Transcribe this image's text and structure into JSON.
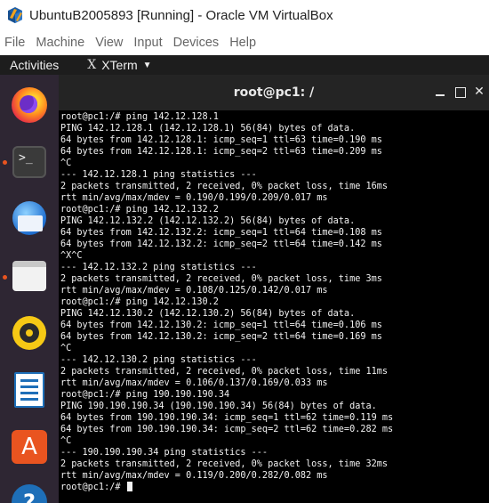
{
  "window": {
    "title": "UbuntuB2005893 [Running] - Oracle VM VirtualBox"
  },
  "menubar": {
    "items": [
      "File",
      "Machine",
      "View",
      "Input",
      "Devices",
      "Help"
    ]
  },
  "topbar": {
    "activities": "Activities",
    "app_glyph": "X",
    "app_name": "XTerm"
  },
  "dock": {
    "items": [
      {
        "name": "firefox",
        "icon": "firefox-icon",
        "running": false
      },
      {
        "name": "terminal",
        "icon": "terminal-icon",
        "glyph": ">_",
        "running": true
      },
      {
        "name": "thunderbird",
        "icon": "thunderbird-icon",
        "running": false
      },
      {
        "name": "files",
        "icon": "files-icon",
        "running": true
      },
      {
        "name": "rhythmbox",
        "icon": "rhythmbox-icon",
        "running": false
      },
      {
        "name": "libreoffice-writer",
        "icon": "writer-icon",
        "running": false
      },
      {
        "name": "software",
        "icon": "software-icon",
        "glyph": "A",
        "running": false
      },
      {
        "name": "help",
        "icon": "help-icon",
        "glyph": "?",
        "running": false
      }
    ]
  },
  "terminal": {
    "title": "root@pc1: /",
    "close_glyph": "✕",
    "lines": [
      "root@pc1:/# ping 142.12.128.1",
      "PING 142.12.128.1 (142.12.128.1) 56(84) bytes of data.",
      "64 bytes from 142.12.128.1: icmp_seq=1 ttl=63 time=0.190 ms",
      "64 bytes from 142.12.128.1: icmp_seq=2 ttl=63 time=0.209 ms",
      "^C",
      "--- 142.12.128.1 ping statistics ---",
      "2 packets transmitted, 2 received, 0% packet loss, time 16ms",
      "rtt min/avg/max/mdev = 0.190/0.199/0.209/0.017 ms",
      "root@pc1:/# ping 142.12.132.2",
      "PING 142.12.132.2 (142.12.132.2) 56(84) bytes of data.",
      "64 bytes from 142.12.132.2: icmp_seq=1 ttl=64 time=0.108 ms",
      "64 bytes from 142.12.132.2: icmp_seq=2 ttl=64 time=0.142 ms",
      "^X^C",
      "--- 142.12.132.2 ping statistics ---",
      "2 packets transmitted, 2 received, 0% packet loss, time 3ms",
      "rtt min/avg/max/mdev = 0.108/0.125/0.142/0.017 ms",
      "root@pc1:/# ping 142.12.130.2",
      "PING 142.12.130.2 (142.12.130.2) 56(84) bytes of data.",
      "64 bytes from 142.12.130.2: icmp_seq=1 ttl=64 time=0.106 ms",
      "64 bytes from 142.12.130.2: icmp_seq=2 ttl=64 time=0.169 ms",
      "^C",
      "--- 142.12.130.2 ping statistics ---",
      "2 packets transmitted, 2 received, 0% packet loss, time 11ms",
      "rtt min/avg/max/mdev = 0.106/0.137/0.169/0.033 ms",
      "root@pc1:/# ping 190.190.190.34",
      "PING 190.190.190.34 (190.190.190.34) 56(84) bytes of data.",
      "64 bytes from 190.190.190.34: icmp_seq=1 ttl=62 time=0.119 ms",
      "64 bytes from 190.190.190.34: icmp_seq=2 ttl=62 time=0.282 ms",
      "^C",
      "--- 190.190.190.34 ping statistics ---",
      "2 packets transmitted, 2 received, 0% packet loss, time 32ms",
      "rtt min/avg/max/mdev = 0.119/0.200/0.282/0.082 ms"
    ],
    "prompt": "root@pc1:/# "
  }
}
